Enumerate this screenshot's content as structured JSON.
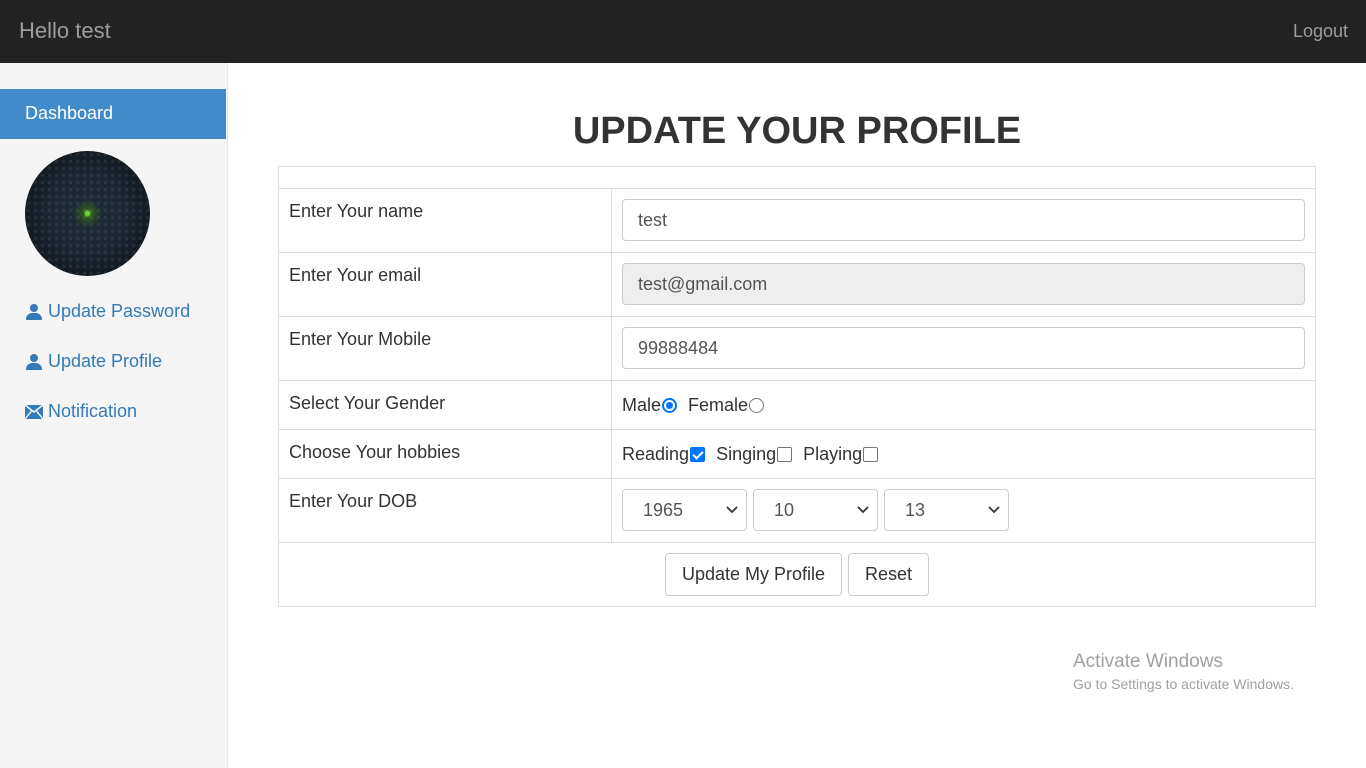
{
  "navbar": {
    "brand": "Hello test",
    "logout": "Logout"
  },
  "sidebar": {
    "dashboard": "Dashboard",
    "items": [
      {
        "label": "Update Password",
        "icon": "user-icon"
      },
      {
        "label": "Update Profile",
        "icon": "user-icon"
      },
      {
        "label": "Notification",
        "icon": "envelope-icon"
      }
    ]
  },
  "main": {
    "title": "UPDATE YOUR PROFILE",
    "form": {
      "name_label": "Enter Your name",
      "name_value": "test",
      "email_label": "Enter Your email",
      "email_value": "test@gmail.com",
      "mobile_label": "Enter Your Mobile",
      "mobile_value": "99888484",
      "gender_label": "Select Your Gender",
      "gender_options": [
        {
          "label": "Male",
          "checked": true
        },
        {
          "label": "Female",
          "checked": false
        }
      ],
      "hobbies_label": "Choose Your hobbies",
      "hobbies_options": [
        {
          "label": "Reading",
          "checked": true
        },
        {
          "label": "Singing",
          "checked": false
        },
        {
          "label": "Playing",
          "checked": false
        }
      ],
      "dob_label": "Enter Your DOB",
      "dob_year": "1965",
      "dob_month": "10",
      "dob_day": "13",
      "update_button": "Update My Profile",
      "reset_button": "Reset"
    }
  },
  "watermark": {
    "line1": "Activate Windows",
    "line2": "Go to Settings to activate Windows."
  },
  "colors": {
    "navbar": "#222222",
    "accent": "#428bca",
    "link": "#337ab7",
    "sidebar": "#f5f5f5"
  }
}
